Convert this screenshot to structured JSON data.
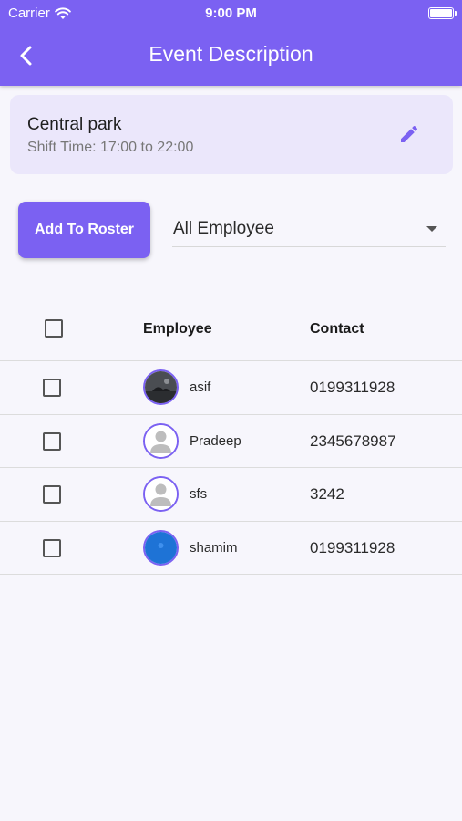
{
  "status_bar": {
    "carrier": "Carrier",
    "time": "9:00 PM"
  },
  "header": {
    "title": "Event Description",
    "back_icon": "chevron-left-icon"
  },
  "event": {
    "name": "Central park",
    "shift_time": "Shift Time: 17:00 to 22:00",
    "edit_icon": "pencil-icon"
  },
  "actions": {
    "add_label": "Add To Roster",
    "filter_value": "All Employee"
  },
  "table": {
    "headers": {
      "employee": "Employee",
      "contact": "Contact"
    },
    "rows": [
      {
        "name": "asif",
        "contact": "0199311928",
        "avatar": "photo"
      },
      {
        "name": "Pradeep",
        "contact": "2345678987",
        "avatar": "placeholder"
      },
      {
        "name": "sfs",
        "contact": "3242",
        "avatar": "placeholder"
      },
      {
        "name": "shamim",
        "contact": "0199311928",
        "avatar": "blue"
      }
    ]
  },
  "colors": {
    "primary": "#7b61f2",
    "card_bg": "#ebe7fb",
    "page_bg": "#f7f6fc"
  }
}
